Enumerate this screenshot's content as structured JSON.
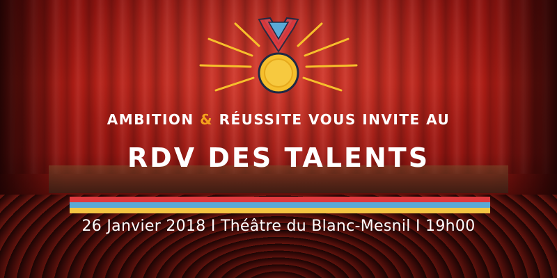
{
  "invite": {
    "organizer_part1": "AMBITION",
    "ampersand": "&",
    "organizer_part2": "RÉUSSITE VOUS INVITE AU"
  },
  "title": "RDV DES TALENTS",
  "details": "26 Janvier 2018 I Théâtre du Blanc-Mesnil I 19h00",
  "colors": {
    "curtain_red": "#b11d15",
    "accent_orange": "#f4a21c",
    "medal_gold": "#f6bf2c",
    "ribbon_blue": "#5aa9d6",
    "stripe_red": "#e03a3e",
    "stripe_blue": "#5aa9d6",
    "stripe_yellow": "#f4c542"
  },
  "icons": {
    "medal": "medal-icon"
  }
}
